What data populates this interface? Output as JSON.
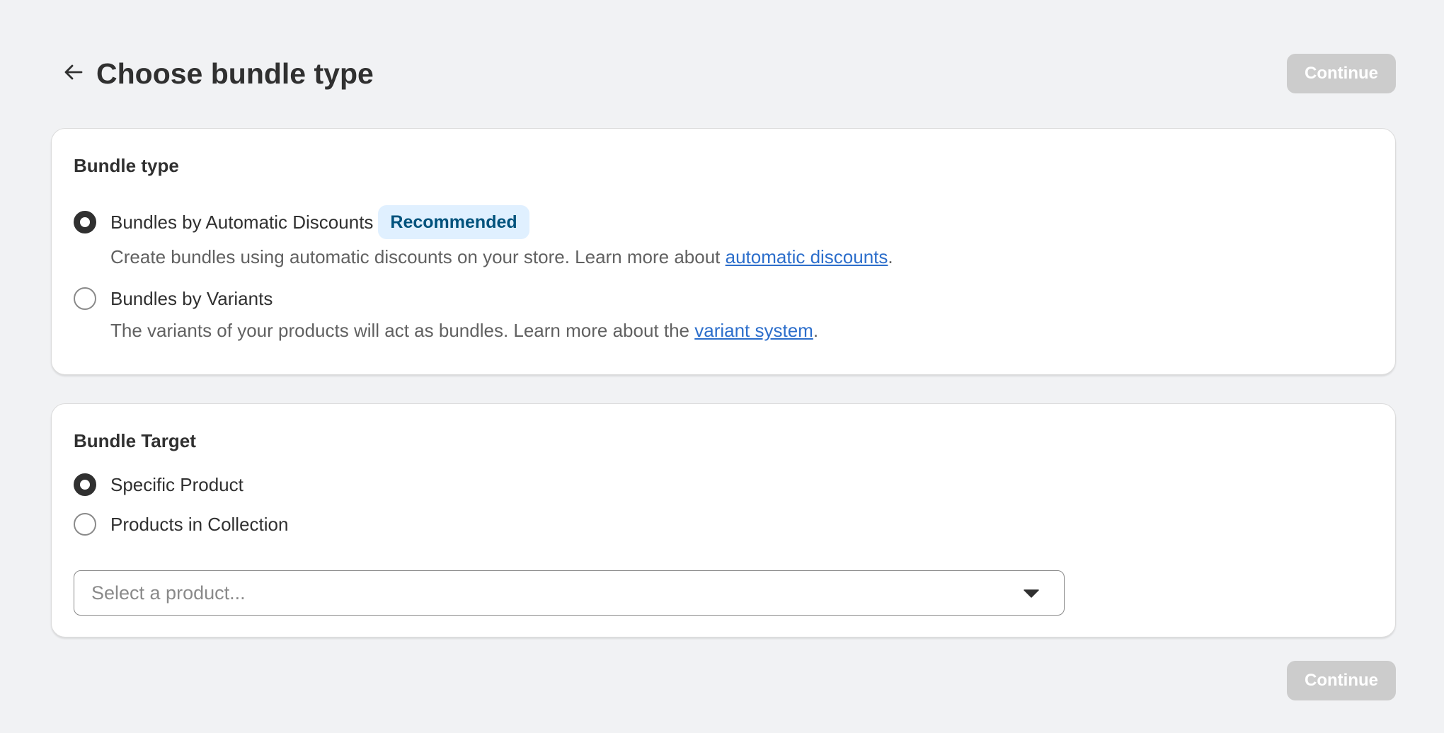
{
  "header": {
    "back_icon": "arrow-left-icon",
    "title": "Choose bundle type",
    "continue_label": "Continue"
  },
  "bundle_type_card": {
    "title": "Bundle type",
    "options": [
      {
        "label": "Bundles by Automatic Discounts",
        "badge": "Recommended",
        "selected": true,
        "help_prefix": "Create bundles using automatic discounts on your store. Learn more about ",
        "help_link": "automatic discounts",
        "help_suffix": "."
      },
      {
        "label": "Bundles by Variants",
        "selected": false,
        "help_prefix": "The variants of your products will act as bundles. Learn more about the ",
        "help_link": "variant system",
        "help_suffix": "."
      }
    ]
  },
  "bundle_target_card": {
    "title": "Bundle Target",
    "options": [
      {
        "label": "Specific Product",
        "selected": true
      },
      {
        "label": "Products in Collection",
        "selected": false
      }
    ],
    "select": {
      "placeholder": "Select a product...",
      "caret_icon": "caret-down-icon"
    }
  },
  "footer": {
    "continue_label": "Continue"
  },
  "colors": {
    "page_background": "#f1f2f4",
    "card_background": "#ffffff",
    "button_disabled": "#cccccc",
    "badge_background": "#e0f0ff",
    "badge_text": "#00527c",
    "link": "#2c6ecb",
    "text_primary": "#303030",
    "text_secondary": "#616161"
  }
}
